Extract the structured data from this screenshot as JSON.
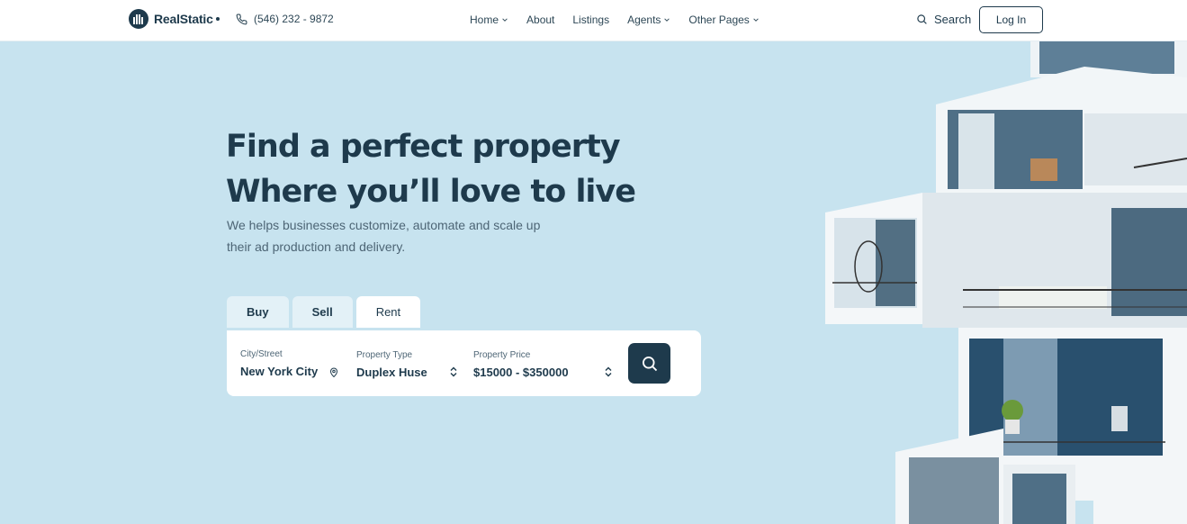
{
  "brand": {
    "name": "RealStatic",
    "phone": "(546) 232 - 9872"
  },
  "nav": [
    {
      "label": "Home",
      "dropdown": true
    },
    {
      "label": "About",
      "dropdown": false
    },
    {
      "label": "Listings",
      "dropdown": false
    },
    {
      "label": "Agents",
      "dropdown": true
    },
    {
      "label": "Other Pages",
      "dropdown": true
    }
  ],
  "header": {
    "search_label": "Search",
    "login_label": "Log In"
  },
  "hero": {
    "title_line1": "Find a perfect property",
    "title_line2": "Where you’ll love to live",
    "subtitle_line1": "We helps businesses customize, automate and scale up",
    "subtitle_line2": "their ad production and delivery."
  },
  "tabs": [
    {
      "label": "Buy",
      "active": false
    },
    {
      "label": "Sell",
      "active": false
    },
    {
      "label": "Rent",
      "active": true
    }
  ],
  "search_form": {
    "city": {
      "label": "City/Street",
      "value": "New York City"
    },
    "type": {
      "label": "Property Type",
      "value": "Duplex Huse"
    },
    "price": {
      "label": "Property Price",
      "value": "$15000 - $350000"
    }
  },
  "colors": {
    "primary": "#1e3a4c",
    "hero_bg": "#c7e3ef",
    "tab_inactive": "#e3f1f7"
  },
  "icons": [
    "phone-icon",
    "search-icon",
    "location-pin-icon",
    "sort-arrows-icon",
    "chevron-down-icon"
  ]
}
